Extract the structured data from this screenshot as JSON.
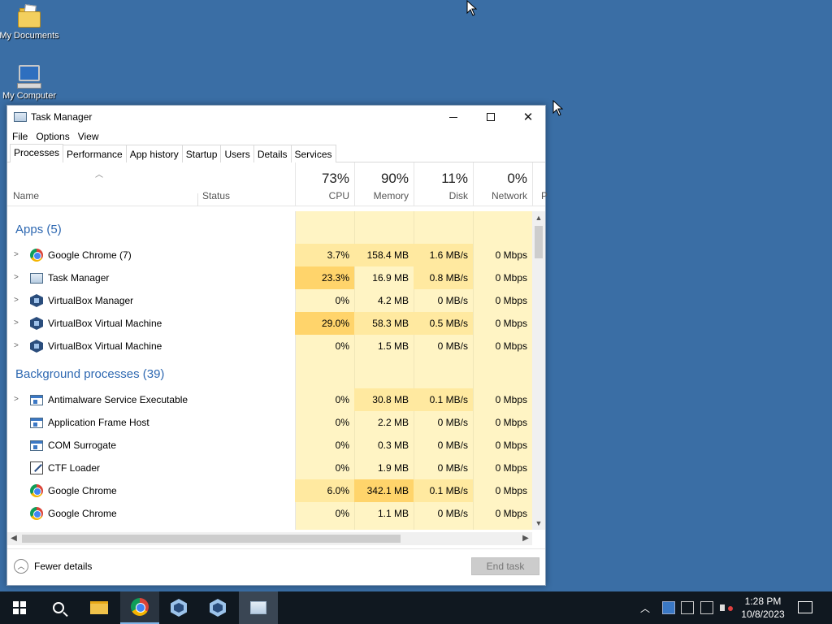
{
  "desktop": {
    "icons": [
      {
        "label": "My Documents"
      },
      {
        "label": "My Computer"
      }
    ]
  },
  "window": {
    "title": "Task Manager",
    "controls": {
      "minimize": "—",
      "close": "✕"
    }
  },
  "menu": [
    "File",
    "Options",
    "View"
  ],
  "tabs": [
    "Processes",
    "Performance",
    "App history",
    "Startup",
    "Users",
    "Details",
    "Services"
  ],
  "active_tab": "Processes",
  "columns": {
    "name": "Name",
    "status": "Status",
    "cpu": {
      "pct": "73%",
      "label": "CPU"
    },
    "memory": {
      "pct": "90%",
      "label": "Memory"
    },
    "disk": {
      "pct": "11%",
      "label": "Disk"
    },
    "network": {
      "pct": "0%",
      "label": "Network"
    },
    "power_partial": "P"
  },
  "groups": {
    "apps": "Apps (5)",
    "background": "Background processes (39)"
  },
  "apps": [
    {
      "name": "Google Chrome (7)",
      "icon": "chrome-icon",
      "cpu": "3.7%",
      "mem": "158.4 MB",
      "disk": "1.6 MB/s",
      "net": "0 Mbps",
      "expandable": true
    },
    {
      "name": "Task Manager",
      "icon": "task-manager-icon",
      "cpu": "23.3%",
      "mem": "16.9 MB",
      "disk": "0.8 MB/s",
      "net": "0 Mbps",
      "expandable": true
    },
    {
      "name": "VirtualBox Manager",
      "icon": "virtualbox-icon",
      "cpu": "0%",
      "mem": "4.2 MB",
      "disk": "0 MB/s",
      "net": "0 Mbps",
      "expandable": true
    },
    {
      "name": "VirtualBox Virtual Machine",
      "icon": "virtualbox-icon",
      "cpu": "29.0%",
      "mem": "58.3 MB",
      "disk": "0.5 MB/s",
      "net": "0 Mbps",
      "expandable": true
    },
    {
      "name": "VirtualBox Virtual Machine",
      "icon": "virtualbox-icon",
      "cpu": "0%",
      "mem": "1.5 MB",
      "disk": "0 MB/s",
      "net": "0 Mbps",
      "expandable": true
    }
  ],
  "background": [
    {
      "name": "Antimalware Service Executable",
      "icon": "app-window-icon",
      "cpu": "0%",
      "mem": "30.8 MB",
      "disk": "0.1 MB/s",
      "net": "0 Mbps",
      "expandable": true
    },
    {
      "name": "Application Frame Host",
      "icon": "app-window-icon",
      "cpu": "0%",
      "mem": "2.2 MB",
      "disk": "0 MB/s",
      "net": "0 Mbps",
      "expandable": false
    },
    {
      "name": "COM Surrogate",
      "icon": "app-window-icon",
      "cpu": "0%",
      "mem": "0.3 MB",
      "disk": "0 MB/s",
      "net": "0 Mbps",
      "expandable": false
    },
    {
      "name": "CTF Loader",
      "icon": "ctf-loader-icon",
      "cpu": "0%",
      "mem": "1.9 MB",
      "disk": "0 MB/s",
      "net": "0 Mbps",
      "expandable": false
    },
    {
      "name": "Google Chrome",
      "icon": "chrome-icon",
      "cpu": "6.0%",
      "mem": "342.1 MB",
      "disk": "0.1 MB/s",
      "net": "0 Mbps",
      "expandable": false
    },
    {
      "name": "Google Chrome",
      "icon": "chrome-icon",
      "cpu": "0%",
      "mem": "1.1 MB",
      "disk": "0 MB/s",
      "net": "0 Mbps",
      "expandable": false
    }
  ],
  "footer": {
    "fewer_details": "Fewer details",
    "end_task": "End task"
  },
  "taskbar": {
    "time": "1:28 PM",
    "date": "10/8/2023"
  },
  "colors": {
    "heat_light": "#fff4c4",
    "heat_mid": "#ffe9a0",
    "heat_high": "#ffd46b",
    "group_title": "#2e68b1",
    "desktop": "#3a6ea5"
  }
}
